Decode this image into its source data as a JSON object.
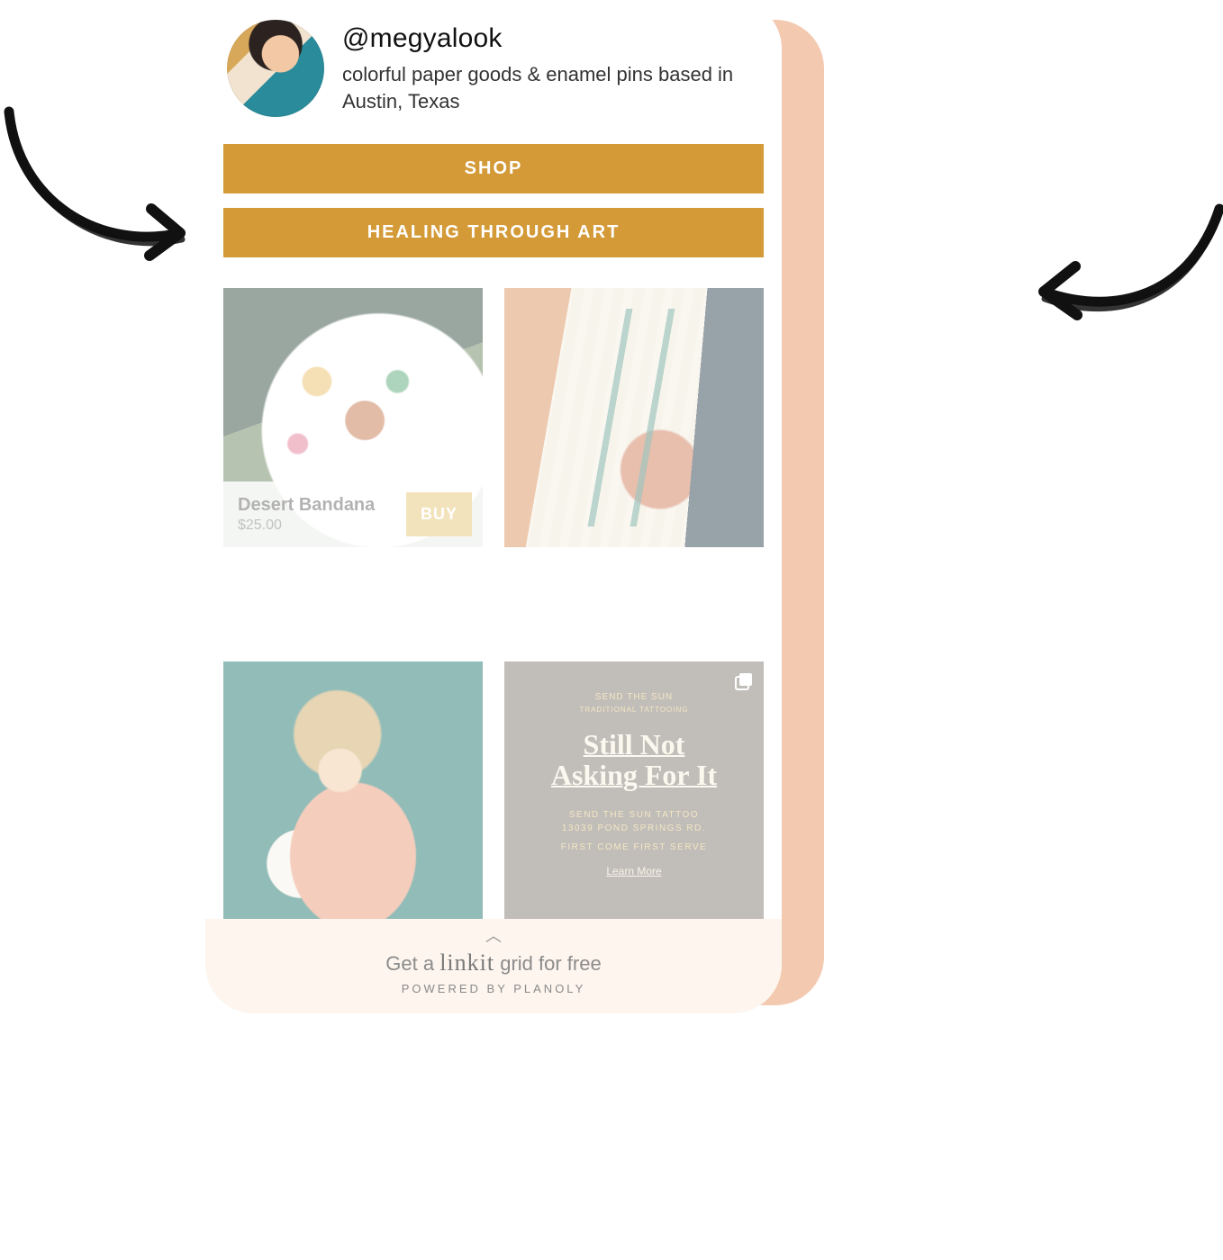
{
  "profile": {
    "handle": "@megyalook",
    "bio": "colorful paper goods & enamel pins based in Austin, Texas"
  },
  "links": [
    {
      "label": "SHOP"
    },
    {
      "label": "HEALING THROUGH ART"
    }
  ],
  "grid": {
    "tile1": {
      "product_name": "Desert Bandana",
      "price": "$25.00",
      "buy_label": "BUY"
    },
    "tile4": {
      "arc_top": "SEND THE SUN",
      "arc_sub": "TRADITIONAL TATTOOING",
      "headline_line1": "Still Not",
      "headline_line2": "Asking For It",
      "detail_line1": "SEND THE SUN TATTOO",
      "detail_line2": "13039 POND SPRINGS RD.",
      "detail_line3": "FIRST COME FIRST SERVE",
      "learn_more": "Learn More"
    }
  },
  "footer": {
    "get_prefix": "Get a ",
    "brand": "linkit",
    "get_suffix": " grid for free",
    "powered": "POWERED BY PLANOLY"
  }
}
